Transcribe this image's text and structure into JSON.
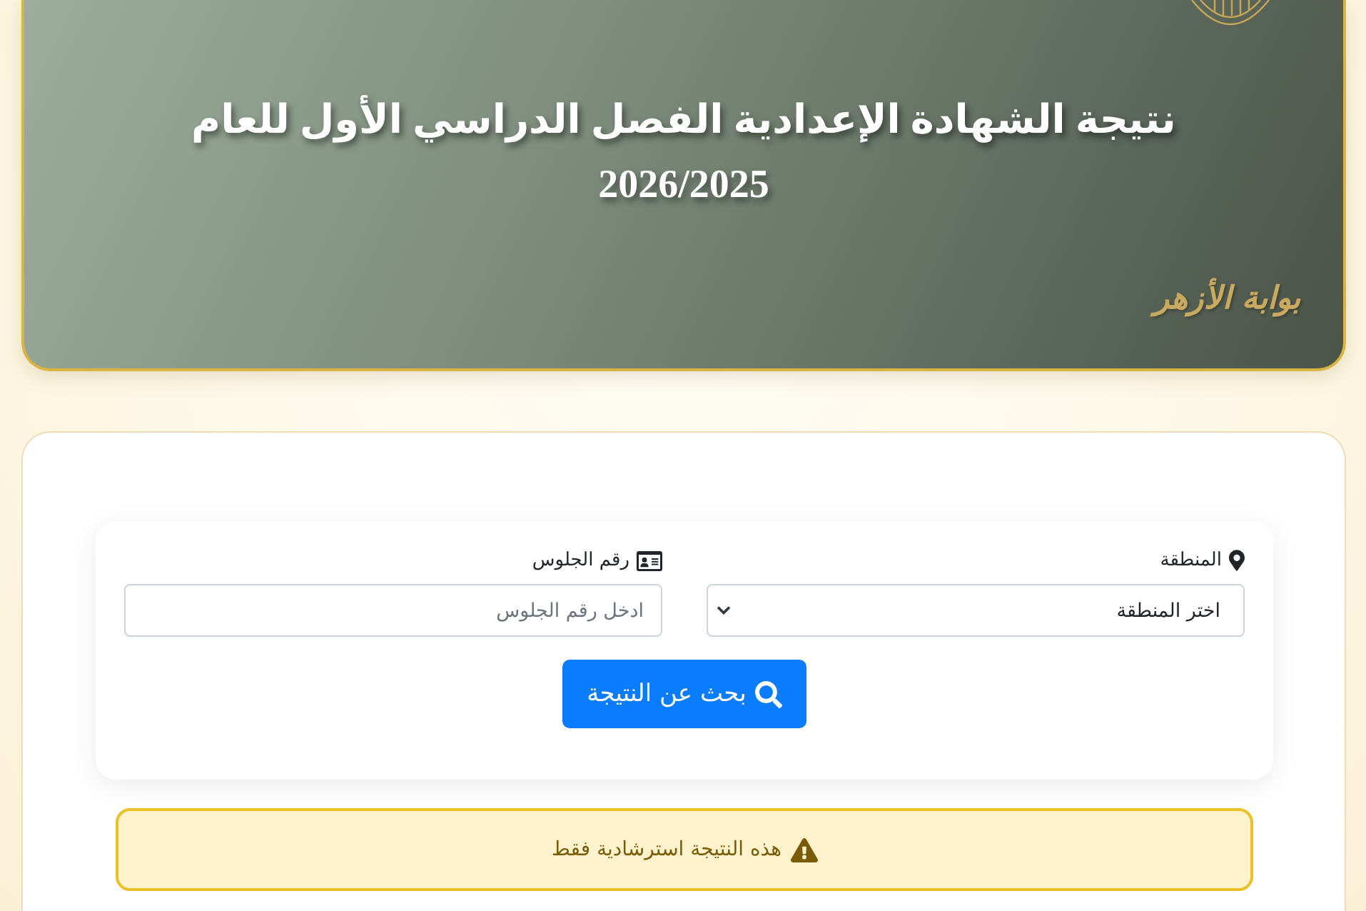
{
  "header": {
    "title": "نتيجة الشهادة الإعدادية الفصل الدراسي الأول للعام 2026/2025",
    "logo_text": "بوابة الأزهر"
  },
  "form": {
    "fields": [
      {
        "kind": "select",
        "label": "المنطقة",
        "value": "اختر المنطقة"
      },
      {
        "kind": "input",
        "label": "رقم الجلوس",
        "placeholder": "ادخل رقم الجلوس"
      }
    ],
    "submit": "بحث عن النتيجة"
  },
  "alert": {
    "text": "هذه النتيجة استرشادية فقط"
  }
}
